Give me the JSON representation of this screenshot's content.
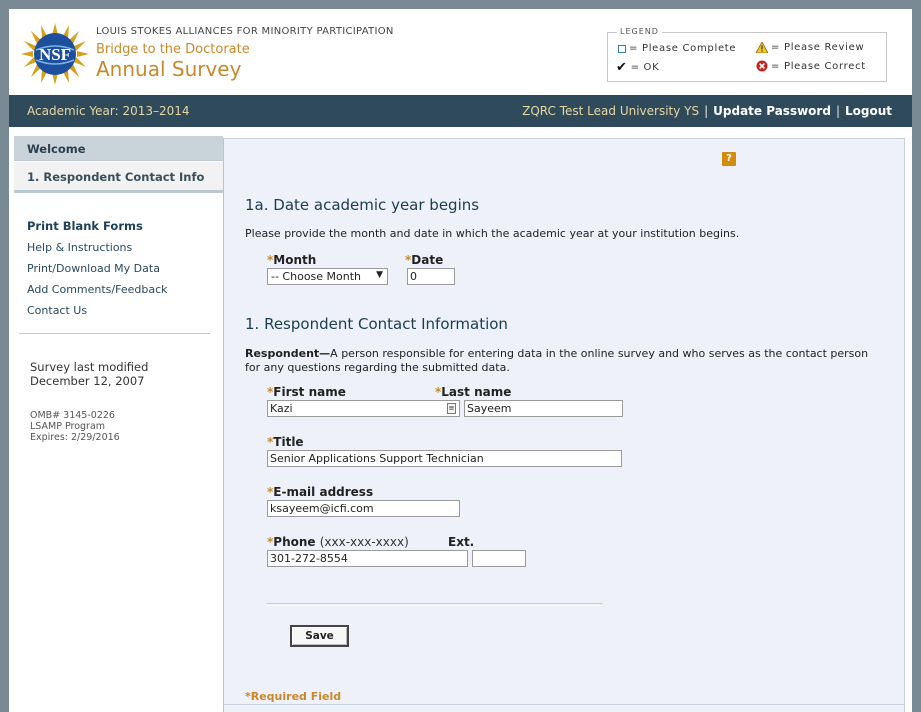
{
  "header": {
    "org": "LOUIS STOKES ALLIANCES FOR MINORITY PARTICIPATION",
    "subtitle": "Bridge to the Doctorate",
    "title": "Annual Survey",
    "logo_text": "NSF"
  },
  "legend": {
    "title": "LEGEND",
    "please_complete": "= Please Complete",
    "please_review": "= Please Review",
    "ok": "= OK",
    "please_correct": "= Please Correct"
  },
  "bar": {
    "academic_year": "Academic Year: 2013–2014",
    "user": "ZQRC Test Lead University YS",
    "separator": "|",
    "update_password": "Update Password",
    "logout": "Logout"
  },
  "sidebar": {
    "tab_welcome": "Welcome",
    "tab_contact": "1. Respondent Contact Info",
    "links": [
      "Print Blank Forms",
      "Help & Instructions",
      "Print/Download My Data",
      "Add Comments/Feedback",
      "Contact Us"
    ],
    "last_modified_label": "Survey last modified",
    "last_modified_date": "December 12, 2007",
    "omb": "OMB# 3145-0226",
    "program": "LSAMP Program",
    "expires": "Expires: 2/29/2016"
  },
  "main": {
    "help_icon": "?",
    "q1a_title": "1a. Date academic year begins",
    "q1a_desc": "Please provide the month and date in which the academic year at your institution begins.",
    "month_label": "Month",
    "month_value": "-- Choose Month",
    "date_label": "Date",
    "date_value": "0",
    "q1_title": "1. Respondent Contact Information",
    "respondent_bold": "Respondent—",
    "respondent_desc": "A person responsible for entering data in the online survey and who serves as the contact person for any questions regarding the submitted data.",
    "required_mark": "*",
    "first_name_label": "First name",
    "first_name_value": "Kazi",
    "last_name_label": "Last name",
    "last_name_value": "Sayeem",
    "title_label": "Title",
    "title_value": "Senior Applications Support Technician",
    "email_label": "E-mail address",
    "email_value": "ksayeem@icfi.com",
    "phone_label": "Phone",
    "phone_hint": "(xxx-xxx-xxxx)",
    "phone_value": "301-272-8554",
    "ext_label": "Ext.",
    "ext_value": "",
    "save_label": "Save",
    "required_note": "*Required Field"
  },
  "colors": {
    "bar_bg": "#2f4a5a",
    "accent_gold": "#c8892a",
    "main_bg": "#eef1fa"
  }
}
